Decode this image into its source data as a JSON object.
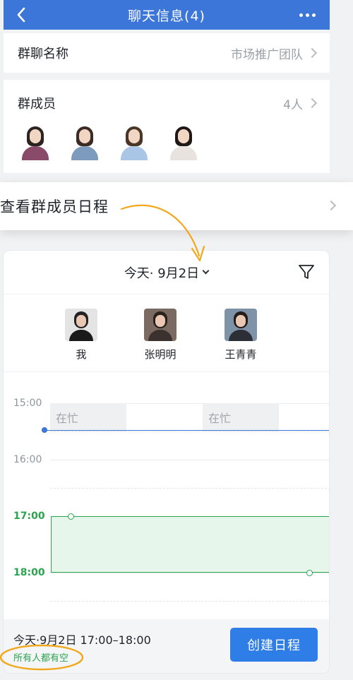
{
  "header": {
    "title": "聊天信息(4)"
  },
  "group_name": {
    "label": "群聊名称",
    "value": "市场推广团队"
  },
  "members": {
    "label": "群成员",
    "count": "4人",
    "avatars": [
      {
        "name": "member-1"
      },
      {
        "name": "member-2"
      },
      {
        "name": "member-3"
      },
      {
        "name": "member-4"
      }
    ]
  },
  "callout": {
    "text": "查看群成员日程"
  },
  "schedule": {
    "date": "今天· 9月2日",
    "people": [
      {
        "name": "我"
      },
      {
        "name": "张明明"
      },
      {
        "name": "王青青"
      }
    ],
    "times": [
      "15:00",
      "16:00",
      "17:00",
      "18:00"
    ],
    "busy_label": "在忙",
    "footer": {
      "range": "今天·9月2日 17:00–18:00",
      "status": "所有人都有空",
      "create_button": "创建日程"
    }
  },
  "colors": {
    "header_blue": "#3b76d8",
    "accent_green": "#2aa44f",
    "annotation_orange": "#f2a81d",
    "button_blue": "#2f7ee8"
  },
  "icons": [
    "back-icon",
    "more-icon",
    "chevron-right-icon",
    "caret-down-icon",
    "filter-icon"
  ]
}
